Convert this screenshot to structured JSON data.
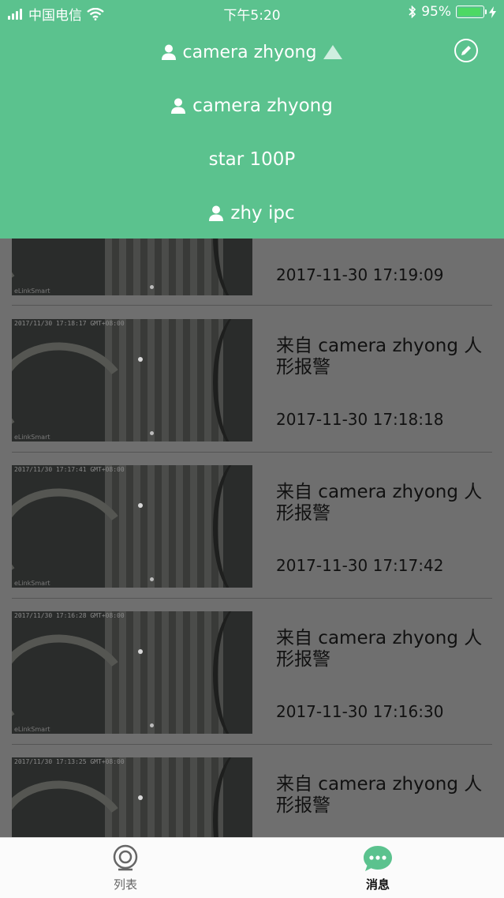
{
  "status_bar": {
    "carrier": "中国电信",
    "time": "下午5:20",
    "battery_percent": "95%",
    "battery_level": 0.95
  },
  "header": {
    "title": "camera zhyong",
    "edit_icon": "pencil-circle-icon",
    "dropdown_indicator": "triangle-up-icon"
  },
  "dropdown": {
    "items": [
      {
        "label": "camera zhyong",
        "icon": "person-icon"
      },
      {
        "label": "star 100P",
        "icon": ""
      },
      {
        "label": "zhy ipc",
        "icon": "person-icon"
      }
    ]
  },
  "messages": [
    {
      "text": "",
      "time": "2017-11-30 17:19:09",
      "thumb_timestamp": "",
      "thumb_brand": "eLinkSmart"
    },
    {
      "text": "来自 camera zhyong 人形报警",
      "time": "2017-11-30 17:18:18",
      "thumb_timestamp": "2017/11/30 17:18:17 GMT+08:00",
      "thumb_brand": "eLinkSmart"
    },
    {
      "text": "来自 camera zhyong 人形报警",
      "time": "2017-11-30 17:17:42",
      "thumb_timestamp": "2017/11/30 17:17:41 GMT+08:00",
      "thumb_brand": "eLinkSmart"
    },
    {
      "text": "来自 camera zhyong 人形报警",
      "time": "2017-11-30 17:16:30",
      "thumb_timestamp": "2017/11/30 17:16:28 GMT+08:00",
      "thumb_brand": "eLinkSmart"
    },
    {
      "text": "来自 camera zhyong 人形报警",
      "time": "",
      "thumb_timestamp": "2017/11/30 17:13:25 GMT+08:00",
      "thumb_brand": ""
    }
  ],
  "tabs": [
    {
      "label": "列表",
      "icon": "camera-icon",
      "active": false
    },
    {
      "label": "消息",
      "icon": "chat-bubble-icon",
      "active": true
    }
  ],
  "colors": {
    "accent": "#5bc28e",
    "tab_inactive": "#666666",
    "tab_active": "#111111"
  }
}
